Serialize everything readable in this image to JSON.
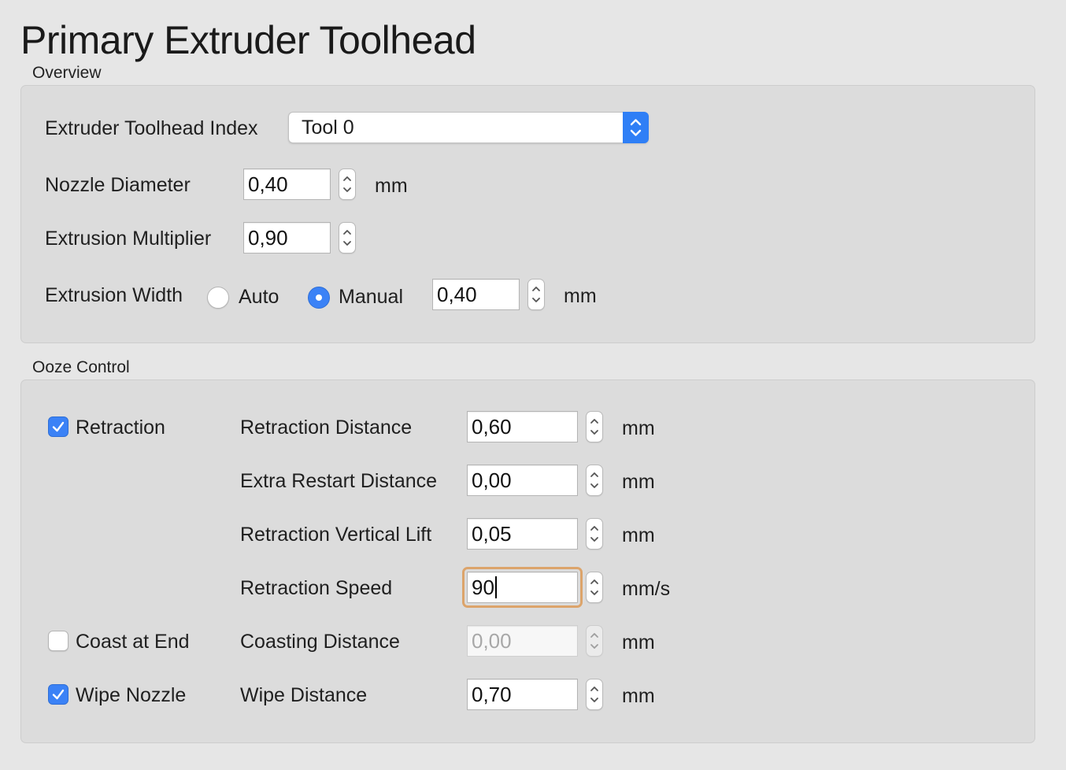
{
  "window": {
    "title": "Primary Extruder Toolhead"
  },
  "colors": {
    "accent": "#3b82f6",
    "focus_ring": "#dca46b",
    "background": "#e6e6e6",
    "group_box": "#dcdcdc"
  },
  "overview": {
    "caption": "Overview",
    "toolhead_index": {
      "label": "Extruder Toolhead Index",
      "selected": "Tool 0",
      "icon": "chevron-up-down-icon"
    },
    "nozzle_diameter": {
      "label": "Nozzle Diameter",
      "value": "0,40",
      "unit": "mm"
    },
    "extrusion_multiplier": {
      "label": "Extrusion Multiplier",
      "value": "0,90"
    },
    "extrusion_width": {
      "label": "Extrusion Width",
      "auto_label": "Auto",
      "manual_label": "Manual",
      "selected": "Manual",
      "value": "0,40",
      "unit": "mm"
    }
  },
  "ooze_control": {
    "caption": "Ooze Control",
    "retraction": {
      "label": "Retraction",
      "checked": true
    },
    "coast_at_end": {
      "label": "Coast at End",
      "checked": false
    },
    "wipe_nozzle": {
      "label": "Wipe Nozzle",
      "checked": true
    },
    "retraction_distance": {
      "label": "Retraction Distance",
      "value": "0,60",
      "unit": "mm"
    },
    "extra_restart_distance": {
      "label": "Extra Restart Distance",
      "value": "0,00",
      "unit": "mm"
    },
    "retraction_vertical_lift": {
      "label": "Retraction Vertical Lift",
      "value": "0,05",
      "unit": "mm"
    },
    "retraction_speed": {
      "label": "Retraction Speed",
      "value": "90",
      "unit": "mm/s",
      "focused": true
    },
    "coasting_distance": {
      "label": "Coasting Distance",
      "value": "0,00",
      "unit": "mm",
      "enabled": false
    },
    "wipe_distance": {
      "label": "Wipe Distance",
      "value": "0,70",
      "unit": "mm"
    }
  }
}
